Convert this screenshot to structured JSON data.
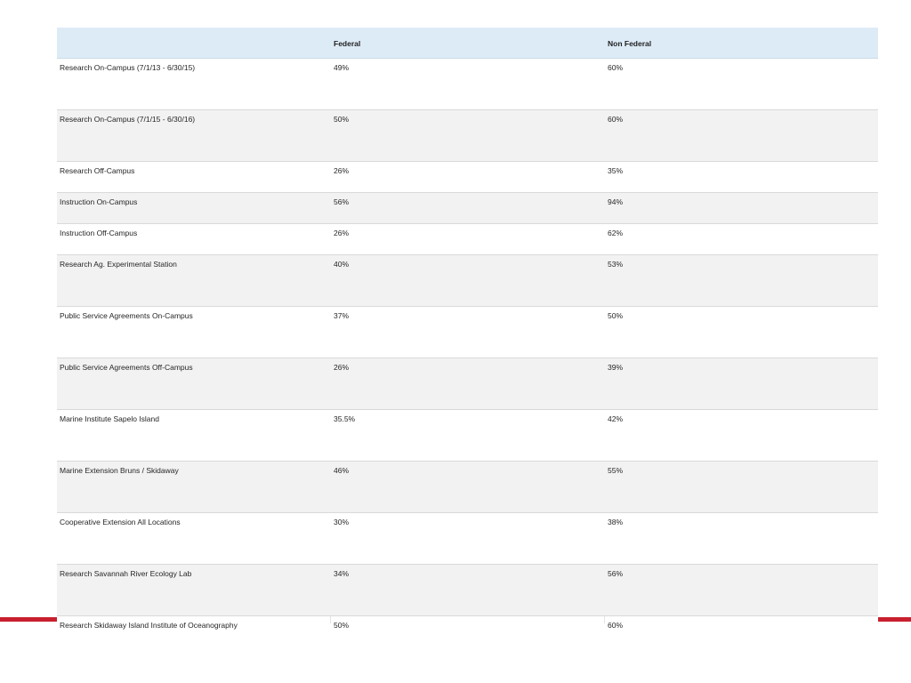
{
  "table": {
    "headers": [
      "",
      "Federal",
      "Non Federal"
    ],
    "rows": [
      {
        "label": "Research On-Campus (7/1/13 - 6/30/15)",
        "federal": "49%",
        "non_federal": "60%"
      },
      {
        "label": "Research On-Campus (7/1/15 - 6/30/16)",
        "federal": "50%",
        "non_federal": "60%"
      },
      {
        "label": "Research Off-Campus",
        "federal": "26%",
        "non_federal": "35%"
      },
      {
        "label": "Instruction On-Campus",
        "federal": "56%",
        "non_federal": "94%"
      },
      {
        "label": "Instruction Off-Campus",
        "federal": "26%",
        "non_federal": "62%"
      },
      {
        "label": "Research Ag. Experimental Station",
        "federal": "40%",
        "non_federal": "53%"
      },
      {
        "label": "Public Service Agreements On-Campus",
        "federal": "37%",
        "non_federal": "50%"
      },
      {
        "label": "Public Service Agreements Off-Campus",
        "federal": "26%",
        "non_federal": "39%"
      },
      {
        "label": "Marine Institute Sapelo Island",
        "federal": "35.5%",
        "non_federal": "42%"
      },
      {
        "label": "Marine Extension Bruns / Skidaway",
        "federal": "46%",
        "non_federal": "55%"
      },
      {
        "label": "Cooperative Extension All Locations",
        "federal": "30%",
        "non_federal": "38%"
      },
      {
        "label": "Research Savannah River Ecology Lab",
        "federal": "34%",
        "non_federal": "56%"
      },
      {
        "label": "Research Skidaway Island Institute of Oceanography",
        "federal": "50%",
        "non_federal": "60%"
      }
    ]
  },
  "colors": {
    "header_background": "#ddebf7",
    "alternate_row_background": "#f2f2f2",
    "accent_rule": "#c8202f"
  }
}
